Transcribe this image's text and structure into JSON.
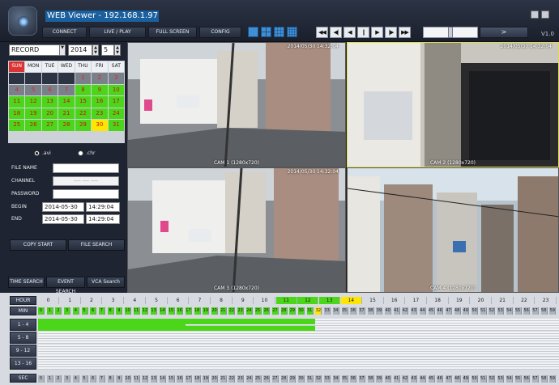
{
  "app": {
    "title": "WEB Viewer - 192.168.1.97",
    "version": "V1.0"
  },
  "nav": [
    "CONNECT",
    "LIVE / PLAY",
    "FULL SCREEN",
    "CONFIG"
  ],
  "layout_icons": [
    "single-view-icon",
    "quad-view-icon",
    "nine-view-icon",
    "sixteen-view-icon"
  ],
  "playback": [
    "◀◀",
    "◀|",
    "◀",
    "||",
    "▶",
    "|▶",
    "▶▶"
  ],
  "go_label": ">",
  "search": {
    "mode": "RECORD",
    "year": "2014",
    "month": "5"
  },
  "calendar": {
    "days_header": [
      "SUN",
      "MON",
      "TUE",
      "WED",
      "THU",
      "FRI",
      "SAT"
    ],
    "cells": [
      [
        "",
        "",
        "",
        "",
        "1",
        "2",
        "3"
      ],
      [
        "4",
        "5",
        "6",
        "7",
        "8",
        "9",
        "10"
      ],
      [
        "11",
        "12",
        "13",
        "14",
        "15",
        "16",
        "17"
      ],
      [
        "18",
        "19",
        "20",
        "21",
        "22",
        "23",
        "24"
      ],
      [
        "25",
        "26",
        "27",
        "28",
        "29",
        "30",
        "31"
      ]
    ],
    "recorded_days": [
      "8",
      "9",
      "10",
      "11",
      "12",
      "13",
      "14",
      "15",
      "16",
      "17",
      "18",
      "19",
      "20",
      "21",
      "22",
      "23",
      "24",
      "25",
      "26",
      "27",
      "28",
      "29",
      "31"
    ],
    "selected_day": "30"
  },
  "format": {
    "avi": ".avi",
    "chr": ".chr",
    "selected": ".avi"
  },
  "form": {
    "file_name_label": "FILE NAME",
    "channel_label": "CHANNEL",
    "channel_value": "---- ---- ----",
    "password_label": "PASSWORD",
    "begin_label": "BEGIN",
    "end_label": "END",
    "begin_date": "2014-05-30",
    "begin_time": "14:29:04",
    "end_date": "2014-05-30",
    "end_time": "14:29:04"
  },
  "buttons": {
    "copy_start": "COPY START",
    "file_search": "FILE SEARCH",
    "time_search": "TIME SEARCH",
    "event_search": "EVENT SEARCH",
    "vca_search": "VCA Search"
  },
  "cameras": [
    {
      "label": "CAM 1 (1280x720)",
      "timestamp": "2014/05/30 14:32:04"
    },
    {
      "label": "CAM 2 (1280x720)",
      "timestamp": "2014/05/30 14:32:04"
    },
    {
      "label": "CAM 3 (1280x720)",
      "timestamp": "2014/05/30 14:32:04"
    },
    {
      "label": "CAM 4 (1280x720)",
      "timestamp": ""
    }
  ],
  "timeline": {
    "hour_label": "HOUR",
    "min_label": "MIN",
    "sec_label": "SEC",
    "hours": [
      "0",
      "1",
      "2",
      "3",
      "4",
      "5",
      "6",
      "7",
      "8",
      "9",
      "10",
      "11",
      "12",
      "13",
      "14",
      "15",
      "16",
      "17",
      "18",
      "19",
      "20",
      "21",
      "22",
      "23"
    ],
    "recorded_hours": [
      "11",
      "12",
      "13"
    ],
    "current_hour": "14",
    "recorded_minutes_to": 31,
    "current_minute": "32",
    "channel_groups": [
      "1 - 4",
      "5 - 8",
      "9 - 12",
      "13 - 16"
    ],
    "recorded_channels_upto_minute": 31
  },
  "colors": {
    "accent": "#1a5f9e",
    "record": "#4bd61a",
    "selected": "#ffe600",
    "sunday": "#dd3333"
  }
}
